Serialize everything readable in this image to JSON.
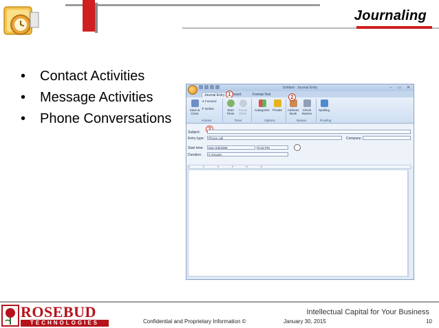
{
  "slide": {
    "title": "Journaling",
    "bullets": [
      "Contact Activities",
      "Message Activities",
      "Phone Conversations"
    ],
    "bullet_glyph": "•"
  },
  "window": {
    "title": "Untitled - Journal Entry",
    "tabs": [
      "Journal Entry",
      "Insert",
      "Format Text"
    ],
    "window_controls": "– ▭ ✕",
    "ribbon_buttons": [
      {
        "label": "Save & Close",
        "icon": "save-close-icon"
      },
      {
        "label": "Forward",
        "icon": "forward-icon"
      },
      {
        "label": "Delete",
        "icon": "delete-icon"
      },
      {
        "label": "Start Timer",
        "icon": "start-timer-icon"
      },
      {
        "label": "Pause Timer",
        "icon": "pause-timer-icon"
      },
      {
        "label": "Categorize",
        "icon": "categorize-icon"
      },
      {
        "label": "Private",
        "icon": "lock-icon"
      },
      {
        "label": "Address Book",
        "icon": "address-book-icon"
      },
      {
        "label": "Check Names",
        "icon": "check-names-icon"
      },
      {
        "label": "Spelling",
        "icon": "spelling-icon"
      }
    ],
    "groups": [
      "Actions",
      "Timer",
      "Options",
      "Names",
      "Proofing"
    ],
    "form": {
      "subject_label": "Subject:",
      "subject_value": "",
      "entry_type_label": "Entry type:",
      "entry_type_value": "Phone call",
      "company_label": "Company:",
      "company_value": "",
      "start_time_label": "Start time:",
      "start_date_value": "Mon 5/5/2008",
      "start_time_value": "9:19 PM",
      "duration_label": "Duration:",
      "duration_value": "0 minutes"
    },
    "ruler_text": "1 2 3 4 5 6",
    "callouts": [
      "1",
      "2",
      "3"
    ]
  },
  "footer": {
    "brand_top": "ROSEBUD",
    "brand_bottom": "TECHNOLOGIES",
    "tagline": "Intellectual Capital for Your Business",
    "confidential": "Confidential and Proprietary Information ©",
    "date": "January 30, 2015",
    "page": "10"
  },
  "colors": {
    "accent_red": "#d01f1f",
    "brand_red": "#b5121b",
    "rule_gray": "#9a9a9a"
  }
}
